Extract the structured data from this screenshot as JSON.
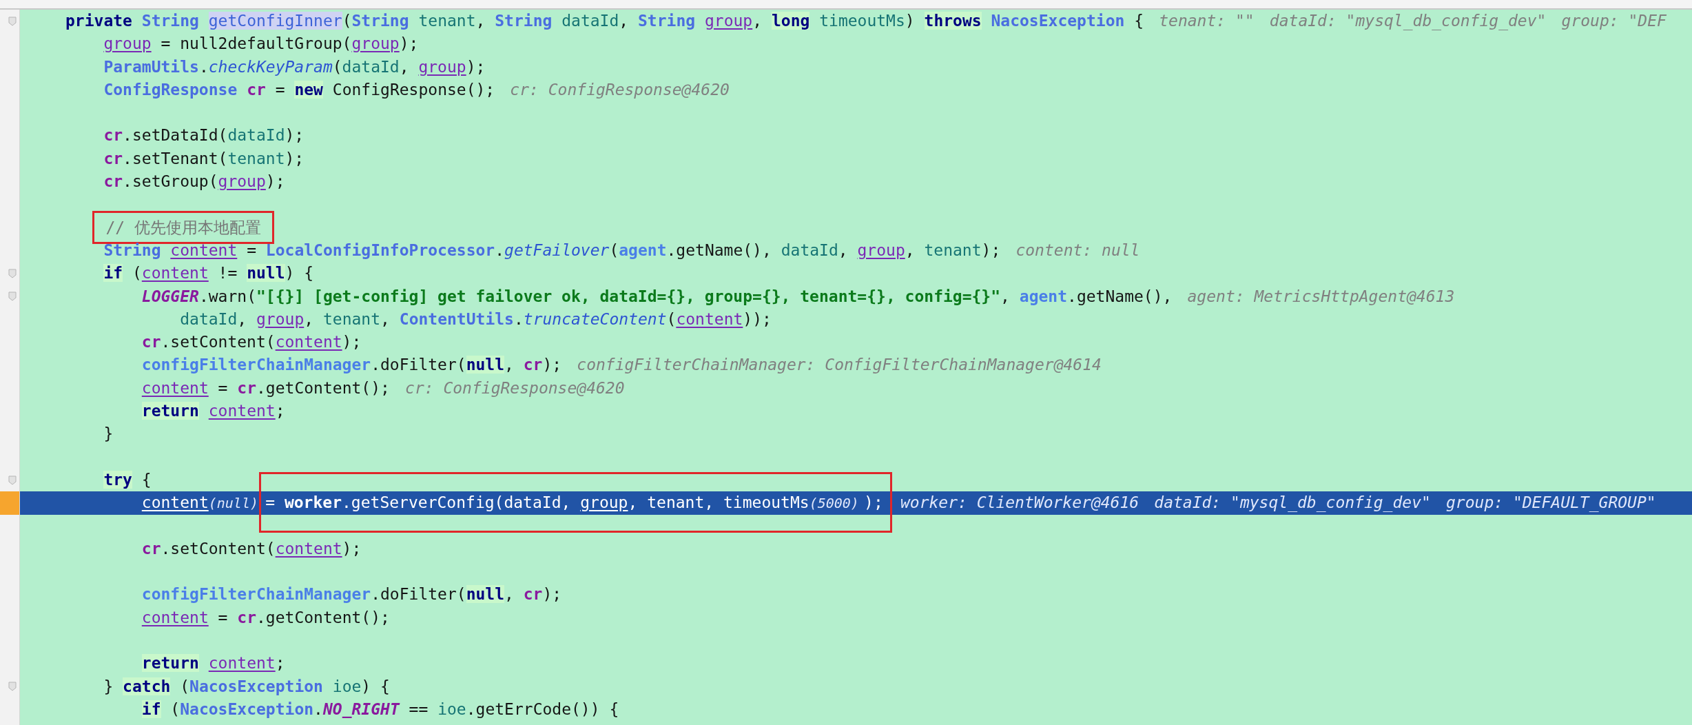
{
  "editor": {
    "lines": [
      {
        "kind": "code",
        "tokens": [
          {
            "text": "private ",
            "kind": "kw"
          },
          {
            "text": "String ",
            "kind": "type"
          },
          {
            "text": "getConfigInner",
            "kind": "decl"
          },
          {
            "text": "(",
            "kind": "p"
          },
          {
            "text": "String ",
            "kind": "type"
          },
          {
            "text": "tenant",
            "kind": "param"
          },
          {
            "text": ", ",
            "kind": "p"
          },
          {
            "text": "String ",
            "kind": "type"
          },
          {
            "text": "dataId",
            "kind": "param"
          },
          {
            "text": ", ",
            "kind": "p"
          },
          {
            "text": "String ",
            "kind": "type"
          },
          {
            "text": "group",
            "kind": "var"
          },
          {
            "text": ", ",
            "kind": "p"
          },
          {
            "text": "long",
            "kind": "kwbg"
          },
          {
            "text": " timeoutMs",
            "kind": "param"
          },
          {
            "text": ") ",
            "kind": "p"
          },
          {
            "text": "throws",
            "kind": "kwbg"
          },
          {
            "text": " NacosException",
            "kind": "type"
          },
          {
            "text": " {",
            "kind": "p"
          },
          {
            "text": "tenant: \"\"",
            "kind": "hint"
          },
          {
            "text": "dataId: \"mysql_db_config_dev\"",
            "kind": "hint"
          },
          {
            "text": "group: \"DEF",
            "kind": "hint"
          }
        ],
        "children": [
          {
            "kind": "code",
            "tokens": [
              {
                "text": "group",
                "kind": "var"
              },
              {
                "text": " = null2defaultGroup(",
                "kind": "p"
              },
              {
                "text": "group",
                "kind": "var"
              },
              {
                "text": ");",
                "kind": "p"
              }
            ]
          },
          {
            "kind": "code",
            "tokens": [
              {
                "text": "ParamUtils",
                "kind": "type"
              },
              {
                "text": ".",
                "kind": "p"
              },
              {
                "text": "checkKeyParam",
                "kind": "static"
              },
              {
                "text": "(",
                "kind": "p"
              },
              {
                "text": "dataId",
                "kind": "param"
              },
              {
                "text": ", ",
                "kind": "p"
              },
              {
                "text": "group",
                "kind": "var"
              },
              {
                "text": ");",
                "kind": "p"
              }
            ]
          },
          {
            "kind": "code",
            "tokens": [
              {
                "text": "ConfigResponse ",
                "kind": "type"
              },
              {
                "text": "cr",
                "kind": "cr"
              },
              {
                "text": " = ",
                "kind": "p"
              },
              {
                "text": "new",
                "kind": "kwbg"
              },
              {
                "text": " ConfigResponse();",
                "kind": "p"
              },
              {
                "text": "cr: ConfigResponse@4620",
                "kind": "hint"
              }
            ]
          },
          {
            "kind": "blank"
          },
          {
            "kind": "code",
            "tokens": [
              {
                "text": "cr",
                "kind": "cr"
              },
              {
                "text": ".setDataId(",
                "kind": "p"
              },
              {
                "text": "dataId",
                "kind": "param"
              },
              {
                "text": ");",
                "kind": "p"
              }
            ]
          },
          {
            "kind": "code",
            "tokens": [
              {
                "text": "cr",
                "kind": "cr"
              },
              {
                "text": ".setTenant(",
                "kind": "p"
              },
              {
                "text": "tenant",
                "kind": "param"
              },
              {
                "text": ");",
                "kind": "p"
              }
            ]
          },
          {
            "kind": "code",
            "tokens": [
              {
                "text": "cr",
                "kind": "cr"
              },
              {
                "text": ".setGroup(",
                "kind": "p"
              },
              {
                "text": "group",
                "kind": "var"
              },
              {
                "text": ");",
                "kind": "p"
              }
            ]
          },
          {
            "kind": "blank"
          },
          {
            "kind": "code",
            "tokens": [
              {
                "box": [
                  {
                    "text": "// 优先使用本地配置",
                    "kind": "cmt"
                  }
                ]
              }
            ]
          },
          {
            "kind": "code",
            "tokens": [
              {
                "text": "String ",
                "kind": "type"
              },
              {
                "text": "content",
                "kind": "var"
              },
              {
                "text": " = ",
                "kind": "p"
              },
              {
                "text": "LocalConfigInfoProcessor",
                "kind": "type"
              },
              {
                "text": ".",
                "kind": "p"
              },
              {
                "text": "getFailover",
                "kind": "static"
              },
              {
                "text": "(",
                "kind": "p"
              },
              {
                "text": "agent",
                "kind": "field"
              },
              {
                "text": ".getName(), ",
                "kind": "p"
              },
              {
                "text": "dataId",
                "kind": "param"
              },
              {
                "text": ", ",
                "kind": "p"
              },
              {
                "text": "group",
                "kind": "var"
              },
              {
                "text": ", ",
                "kind": "p"
              },
              {
                "text": "tenant",
                "kind": "param"
              },
              {
                "text": ");",
                "kind": "p"
              },
              {
                "text": "content: null",
                "kind": "hint"
              }
            ]
          },
          {
            "kind": "code",
            "tokens": [
              {
                "text": "if",
                "kind": "kwbg"
              },
              {
                "text": " (",
                "kind": "p"
              },
              {
                "text": "content",
                "kind": "var"
              },
              {
                "text": " != ",
                "kind": "p"
              },
              {
                "text": "null",
                "kind": "kwbg"
              },
              {
                "text": ") {",
                "kind": "p"
              }
            ],
            "children": [
              {
                "kind": "code",
                "tokens": [
                  {
                    "text": "LOGGER",
                    "kind": "const"
                  },
                  {
                    "text": ".warn(",
                    "kind": "p"
                  },
                  {
                    "text": "\"[{}] [get-config] get failover ok, dataId={}, group={}, tenant={}, config={}\"",
                    "kind": "str"
                  },
                  {
                    "text": ", ",
                    "kind": "p"
                  },
                  {
                    "text": "agent",
                    "kind": "field"
                  },
                  {
                    "text": ".getName(),",
                    "kind": "p"
                  },
                  {
                    "text": "agent: MetricsHttpAgent@4613",
                    "kind": "hint"
                  }
                ],
                "children": [
                  {
                    "kind": "code",
                    "tokens": [
                      {
                        "text": "dataId",
                        "kind": "param"
                      },
                      {
                        "text": ", ",
                        "kind": "p"
                      },
                      {
                        "text": "group",
                        "kind": "var"
                      },
                      {
                        "text": ", ",
                        "kind": "p"
                      },
                      {
                        "text": "tenant",
                        "kind": "param"
                      },
                      {
                        "text": ", ",
                        "kind": "p"
                      },
                      {
                        "text": "ContentUtils",
                        "kind": "type"
                      },
                      {
                        "text": ".",
                        "kind": "p"
                      },
                      {
                        "text": "truncateContent",
                        "kind": "static"
                      },
                      {
                        "text": "(",
                        "kind": "p"
                      },
                      {
                        "text": "content",
                        "kind": "var"
                      },
                      {
                        "text": "));",
                        "kind": "p"
                      }
                    ]
                  }
                ]
              },
              {
                "kind": "code",
                "tokens": [
                  {
                    "text": "cr",
                    "kind": "cr"
                  },
                  {
                    "text": ".setContent(",
                    "kind": "p"
                  },
                  {
                    "text": "content",
                    "kind": "var"
                  },
                  {
                    "text": ");",
                    "kind": "p"
                  }
                ]
              },
              {
                "kind": "code",
                "tokens": [
                  {
                    "text": "configFilterChainManager",
                    "kind": "field"
                  },
                  {
                    "text": ".doFilter(",
                    "kind": "p"
                  },
                  {
                    "text": "null",
                    "kind": "kwbg"
                  },
                  {
                    "text": ", ",
                    "kind": "p"
                  },
                  {
                    "text": "cr",
                    "kind": "cr"
                  },
                  {
                    "text": ");",
                    "kind": "p"
                  },
                  {
                    "text": "configFilterChainManager: ConfigFilterChainManager@4614",
                    "kind": "hint"
                  }
                ]
              },
              {
                "kind": "code",
                "tokens": [
                  {
                    "text": "content",
                    "kind": "var"
                  },
                  {
                    "text": " = ",
                    "kind": "p"
                  },
                  {
                    "text": "cr",
                    "kind": "cr"
                  },
                  {
                    "text": ".getContent();",
                    "kind": "p"
                  },
                  {
                    "text": "cr: ConfigResponse@4620",
                    "kind": "hint"
                  }
                ]
              },
              {
                "kind": "code",
                "tokens": [
                  {
                    "text": "return ",
                    "kind": "kwbg"
                  },
                  {
                    "text": "content",
                    "kind": "var"
                  },
                  {
                    "text": ";",
                    "kind": "p"
                  }
                ]
              }
            ]
          },
          {
            "kind": "code",
            "tokens": [
              {
                "text": "}",
                "kind": "p"
              }
            ]
          },
          {
            "kind": "blank"
          },
          {
            "kind": "code",
            "tokens": [
              {
                "text": "try",
                "kind": "kwbg"
              },
              {
                "text": " {",
                "kind": "p"
              }
            ],
            "children": [
              {
                "kind": "current",
                "tokens": [
                  {
                    "text": "content",
                    "kind": "var"
                  },
                  {
                    "text": "(null)",
                    "kind": "inlay"
                  },
                  {
                    "box": [
                      {
                        "text": "= ",
                        "kind": "p"
                      },
                      {
                        "text": "worker",
                        "kind": "field"
                      },
                      {
                        "text": ".getServerConfig(",
                        "kind": "p"
                      },
                      {
                        "text": "dataId",
                        "kind": "param"
                      },
                      {
                        "text": ", ",
                        "kind": "p"
                      },
                      {
                        "text": "group",
                        "kind": "var"
                      },
                      {
                        "text": ", ",
                        "kind": "p"
                      },
                      {
                        "text": "tenant",
                        "kind": "param"
                      },
                      {
                        "text": ", ",
                        "kind": "p"
                      },
                      {
                        "text": "timeoutMs",
                        "kind": "param"
                      },
                      {
                        "text": "(5000)",
                        "kind": "inlay"
                      },
                      {
                        "text": ");",
                        "kind": "p"
                      }
                    ]
                  },
                  {
                    "text": "worker: ClientWorker@4616",
                    "kind": "hint"
                  },
                  {
                    "text": "dataId: \"mysql_db_config_dev\"",
                    "kind": "hint"
                  },
                  {
                    "text": "group: \"DEFAULT_GROUP\"",
                    "kind": "hint"
                  }
                ]
              },
              {
                "kind": "blank"
              },
              {
                "kind": "code",
                "tokens": [
                  {
                    "text": "cr",
                    "kind": "cr"
                  },
                  {
                    "text": ".setContent(",
                    "kind": "p"
                  },
                  {
                    "text": "content",
                    "kind": "var"
                  },
                  {
                    "text": ");",
                    "kind": "p"
                  }
                ]
              },
              {
                "kind": "blank"
              },
              {
                "kind": "code",
                "tokens": [
                  {
                    "text": "configFilterChainManager",
                    "kind": "field"
                  },
                  {
                    "text": ".doFilter(",
                    "kind": "p"
                  },
                  {
                    "text": "null",
                    "kind": "kwbg"
                  },
                  {
                    "text": ", ",
                    "kind": "p"
                  },
                  {
                    "text": "cr",
                    "kind": "cr"
                  },
                  {
                    "text": ");",
                    "kind": "p"
                  }
                ]
              },
              {
                "kind": "code",
                "tokens": [
                  {
                    "text": "content",
                    "kind": "var"
                  },
                  {
                    "text": " = ",
                    "kind": "p"
                  },
                  {
                    "text": "cr",
                    "kind": "cr"
                  },
                  {
                    "text": ".getContent();",
                    "kind": "p"
                  }
                ]
              },
              {
                "kind": "blank"
              },
              {
                "kind": "code",
                "tokens": [
                  {
                    "text": "return ",
                    "kind": "kwbg"
                  },
                  {
                    "text": "content",
                    "kind": "var"
                  },
                  {
                    "text": ";",
                    "kind": "p"
                  }
                ]
              }
            ]
          },
          {
            "kind": "code",
            "tokens": [
              {
                "text": "} ",
                "kind": "p"
              },
              {
                "text": "catch",
                "kind": "kwbg"
              },
              {
                "text": " (",
                "kind": "p"
              },
              {
                "text": "NacosException ",
                "kind": "type"
              },
              {
                "text": "ioe",
                "kind": "param"
              },
              {
                "text": ") {",
                "kind": "p"
              }
            ],
            "children": [
              {
                "kind": "code",
                "tokens": [
                  {
                    "text": "if",
                    "kind": "kwbg"
                  },
                  {
                    "text": " (",
                    "kind": "p"
                  },
                  {
                    "text": "NacosException",
                    "kind": "type"
                  },
                  {
                    "text": ".",
                    "kind": "p"
                  },
                  {
                    "text": "NO_RIGHT",
                    "kind": "const"
                  },
                  {
                    "text": " == ",
                    "kind": "p"
                  },
                  {
                    "text": "ioe",
                    "kind": "param"
                  },
                  {
                    "text": ".getErrCode()) {",
                    "kind": "p"
                  }
                ]
              }
            ]
          }
        ]
      }
    ]
  }
}
